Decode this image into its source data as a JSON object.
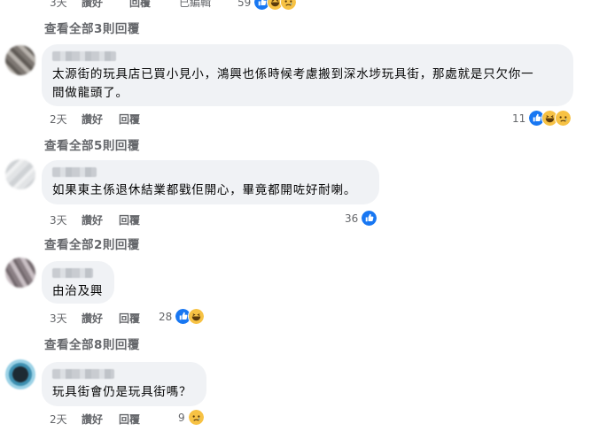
{
  "top": {
    "time": "3天",
    "like": "讚好",
    "reply": "回覆",
    "edited": "已編輯",
    "reaction_count": "59",
    "view_replies": "查看全部3則回覆"
  },
  "comments": [
    {
      "text_line1": "太源街的玩具店已買小見小，鴻興也係時候考慮搬到深水埗玩具街，那處就是只欠你一",
      "text_line2": "間做龍頭了。",
      "time": "2天",
      "like": "讚好",
      "reply": "回覆",
      "reaction_count": "11",
      "reactions": [
        "like-icon",
        "haha-icon",
        "sad-icon"
      ],
      "view_replies": "查看全部5則回覆"
    },
    {
      "text_line1": "如果東主係退休結業都戥佢開心，畢竟都開咗好耐喇。",
      "time": "3天",
      "like": "讚好",
      "reply": "回覆",
      "reaction_count": "36",
      "reactions": [
        "like-icon"
      ],
      "view_replies": "查看全部2則回覆"
    },
    {
      "text_line1": "由治及興",
      "time": "3天",
      "like": "讚好",
      "reply": "回覆",
      "reaction_count": "28",
      "reactions": [
        "like-icon",
        "haha-icon"
      ],
      "view_replies": "查看全部8則回覆"
    },
    {
      "text_line1": "玩具街會仍是玩具街嗎？",
      "time": "2天",
      "like": "讚好",
      "reply": "回覆",
      "reaction_count": "9",
      "reactions": [
        "sad-icon"
      ]
    }
  ],
  "colors": {
    "bubble": "#f0f2f5",
    "meta_text": "#65676b",
    "like_blue": "#1877f2",
    "emoji_yellow": "#f7c244"
  }
}
